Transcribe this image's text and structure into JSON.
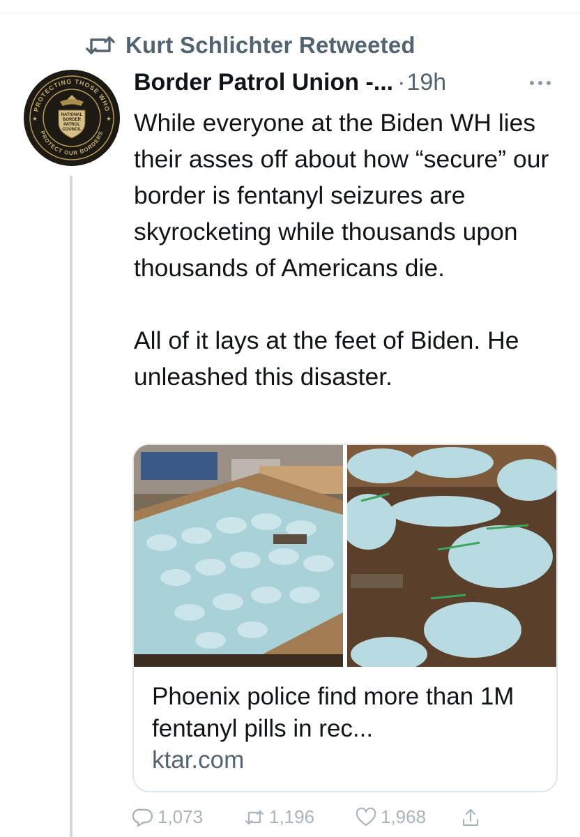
{
  "retweet_banner": {
    "text": "Kurt Schlichter Retweeted",
    "icon": "retweet-icon"
  },
  "author": {
    "display_name": "Border Patrol Union -...",
    "avatar_icon": "nbpc-seal-avatar",
    "avatar_text": [
      "PROTECTING THOSE WHO",
      "NATIONAL",
      "BORDER",
      "PATROL",
      "COUNCIL",
      "PROTECT OUR BORDERS"
    ]
  },
  "tweet": {
    "time": "19h",
    "separator": "·",
    "paragraph1": "While everyone at the Biden WH lies their asses off about how “secure” our border is fentanyl seizures are skyrocketing while thousands upon thousands of Americans die.",
    "paragraph2": "All of it lays at the feet of Biden. He unleashed this disaster."
  },
  "link_card": {
    "title": "Phoenix police find more than 1M fentanyl pills in rec...",
    "domain": "ktar.com",
    "images": [
      "fentanyl-bags-on-table-photo",
      "fentanyl-bags-closeup-photo"
    ]
  },
  "actions": {
    "replies": "1,073",
    "retweets": "1,196",
    "likes": "1,968",
    "icons": [
      "reply-icon",
      "retweet-icon",
      "like-icon",
      "share-icon"
    ]
  },
  "colors": {
    "text": "#0f1419",
    "secondary": "#536471",
    "border": "#dfe5e9",
    "muted": "#aab4bd"
  }
}
